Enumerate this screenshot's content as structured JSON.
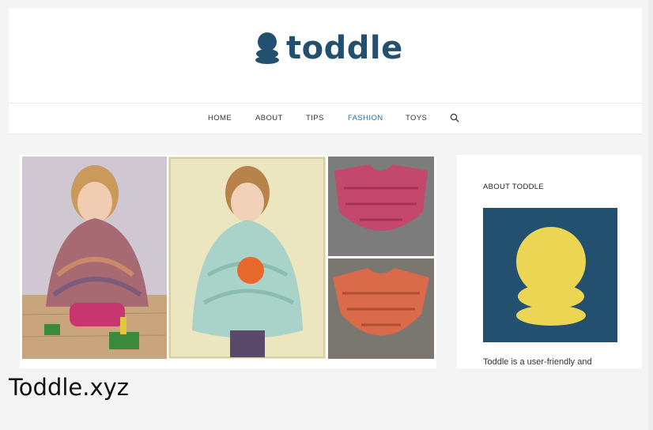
{
  "site": {
    "logo_text": "toddle",
    "logo_icon": "toddle-logo-icon",
    "accent_color": "#24506f",
    "logo_yellow": "#ecd553"
  },
  "nav": {
    "items": [
      {
        "label": "HOME",
        "active": false
      },
      {
        "label": "ABOUT",
        "active": false
      },
      {
        "label": "TIPS",
        "active": false
      },
      {
        "label": "FASHION",
        "active": true
      },
      {
        "label": "TOYS",
        "active": false
      }
    ],
    "search_icon": "search-icon"
  },
  "sidebar": {
    "widget_title": "ABOUT TODDLE",
    "widget_text": "Toddle is a user-friendly and"
  },
  "caption": "Toddle.xyz"
}
